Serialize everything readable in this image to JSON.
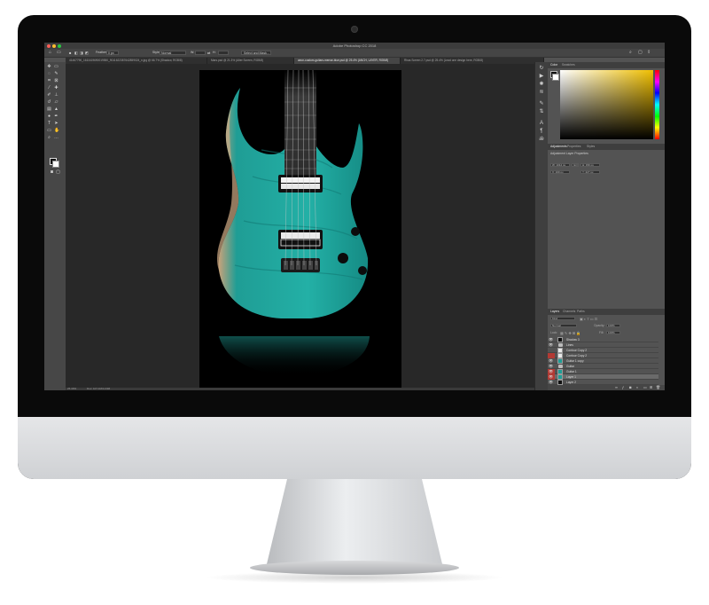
{
  "app": {
    "title": "Adobe Photoshop CC 2018",
    "traffic_light_colors": [
      "#ff5f57",
      "#ffbd2e",
      "#28c840"
    ]
  },
  "options_bar": {
    "feather_label": "Feather:",
    "feather_value": "0 px",
    "style_label": "Style:",
    "style_value": "Normal",
    "width_label": "W:",
    "height_label": "H:",
    "select_mask_button": "Select and Mask..."
  },
  "tabs": [
    {
      "label": "41467790_1611619690019550_9011622387642859024_n.jpg @ 66.7% (Shadow, RGB/8)",
      "active": false
    },
    {
      "label": "Mars.psd @ 21.3% (Alter Screen, RGB/8)",
      "active": false
    },
    {
      "label": "aeon-custom-guitars-mense-blue.psd @ 25.4% (ANCH, LAYER, RGB/8)",
      "active": true
    },
    {
      "label": "Rhas Screen 2.7.psd @ 25.4% (Lead one design here, RGB/8)",
      "active": false
    }
  ],
  "status": {
    "zoom": "25.39%",
    "doc_size": "Doc: 107.1M/4.24M"
  },
  "color_panel": {
    "tabs": [
      "Color",
      "Swatches"
    ],
    "active_tab": "Color",
    "hue_color": "#f0bf00"
  },
  "properties_panel": {
    "tabs": [
      "Adjustments",
      "Properties",
      "Styles"
    ],
    "active_tab": "Adjustments",
    "subtitle": "Adjustment Layer Properties",
    "fields": [
      "W: 1012 px",
      "GO",
      "H: 150 px",
      "X: 100 px",
      "Y: 227 px"
    ]
  },
  "layers_panel": {
    "tabs": [
      "Layers",
      "Channels",
      "Paths"
    ],
    "active_tab": "Layers",
    "search_kind": "Kind",
    "blend_mode": "Normal",
    "opacity_label": "Opacity:",
    "opacity_value": "100%",
    "lock_label": "Lock:",
    "fill_label": "Fill:",
    "fill_value": "100%",
    "layers": [
      {
        "name": "Shadow 3",
        "selected": false,
        "visible": true,
        "marker": false,
        "type": "thumb-dark"
      },
      {
        "name": "Lines",
        "selected": false,
        "visible": true,
        "marker": false,
        "type": "folder"
      },
      {
        "name": "Contour Copy 2",
        "selected": false,
        "visible": false,
        "marker": false,
        "type": "thumb-light"
      },
      {
        "name": "Contour Copy 2",
        "selected": false,
        "visible": false,
        "marker": true,
        "type": "thumb-light"
      },
      {
        "name": "Guitar 1 copy",
        "selected": false,
        "visible": true,
        "marker": false,
        "type": "thumb-teal"
      },
      {
        "name": "Guitar",
        "selected": false,
        "visible": true,
        "marker": false,
        "type": "folder"
      },
      {
        "name": "Guitar 1",
        "selected": false,
        "visible": true,
        "marker": true,
        "type": "thumb-teal"
      },
      {
        "name": "Layer 1",
        "selected": true,
        "visible": true,
        "marker": true,
        "type": "thumb-teal"
      },
      {
        "name": "Layer 2",
        "selected": false,
        "visible": true,
        "marker": false,
        "type": "thumb-dark"
      }
    ]
  }
}
